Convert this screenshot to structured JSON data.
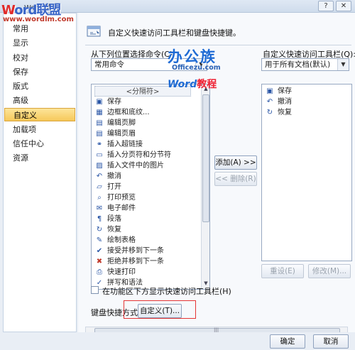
{
  "window": {
    "title": "Word 选项",
    "help_label": "?",
    "close_label": "✕"
  },
  "watermark": {
    "logo_part1": "W",
    "logo_part2": "ord",
    "logo_part3": "联盟",
    "site": "www.wordlm.com",
    "brand_cn": "办公族",
    "brand_en": "Officezu.com",
    "brand_word": "Word",
    "brand_word_suffix": "教程"
  },
  "nav": {
    "items": [
      {
        "label": "常用"
      },
      {
        "label": "显示"
      },
      {
        "label": "校对"
      },
      {
        "label": "保存"
      },
      {
        "label": "版式"
      },
      {
        "label": "高级"
      },
      {
        "label": "自定义",
        "selected": true
      },
      {
        "label": "加载项"
      },
      {
        "label": "信任中心"
      },
      {
        "label": "资源"
      }
    ]
  },
  "main": {
    "header": "自定义快速访问工具栏和键盘快捷键。",
    "choose_label": "从下列位置选择命令(C):",
    "choose_value": "常用命令",
    "customize_label": "自定义快速访问工具栏(Q):",
    "customize_value": "用于所有文档(默认)",
    "commands": [
      {
        "label": "<分隔符>",
        "separator": true
      },
      {
        "label": "保存",
        "icon": "save-icon",
        "glyph": "▣"
      },
      {
        "label": "边框和底纹...",
        "icon": "border-icon",
        "glyph": "▦"
      },
      {
        "label": "编辑页脚",
        "icon": "footer-icon",
        "glyph": "▤"
      },
      {
        "label": "编辑页眉",
        "icon": "header-icon",
        "glyph": "▤"
      },
      {
        "label": "插入超链接",
        "icon": "hyperlink-icon",
        "glyph": "⚭"
      },
      {
        "label": "插入分页符和分节符",
        "icon": "page-break-icon",
        "glyph": "▭",
        "submenu": true
      },
      {
        "label": "插入文件中的图片",
        "icon": "picture-icon",
        "glyph": "▨"
      },
      {
        "label": "撤消",
        "icon": "undo-icon",
        "glyph": "↶",
        "submenu": true
      },
      {
        "label": "打开",
        "icon": "open-icon",
        "glyph": "▱"
      },
      {
        "label": "打印预览",
        "icon": "print-preview-icon",
        "glyph": "⌕"
      },
      {
        "label": "电子邮件",
        "icon": "email-icon",
        "glyph": "✉"
      },
      {
        "label": "段落",
        "icon": "paragraph-icon",
        "glyph": "¶"
      },
      {
        "label": "恢复",
        "icon": "redo-icon",
        "glyph": "↻"
      },
      {
        "label": "绘制表格",
        "icon": "draw-table-icon",
        "glyph": "✎"
      },
      {
        "label": "接受并移到下一条",
        "icon": "accept-icon",
        "glyph": "✔"
      },
      {
        "label": "拒绝并移到下一条",
        "icon": "reject-icon",
        "glyph": "✖"
      },
      {
        "label": "快速打印",
        "icon": "quick-print-icon",
        "glyph": "⎙"
      },
      {
        "label": "拼写和语法",
        "icon": "spelling-icon",
        "glyph": "✓"
      }
    ],
    "qat_items": [
      {
        "label": "保存",
        "icon": "save-icon",
        "glyph": "▣"
      },
      {
        "label": "撤消",
        "icon": "undo-icon",
        "glyph": "↶"
      },
      {
        "label": "恢复",
        "icon": "redo-icon",
        "glyph": "↻"
      }
    ],
    "add_button": "添加(A) >>",
    "remove_button": "<< 删除(R)",
    "reset_button": "重设(E)",
    "modify_button": "修改(M)...",
    "show_below_ribbon": "在功能区下方显示快速访问工具栏(H)",
    "keyboard_label": "键盘快捷方式:",
    "customize_button": "自定义(T)..."
  },
  "footer": {
    "ok": "确定",
    "cancel": "取消"
  }
}
